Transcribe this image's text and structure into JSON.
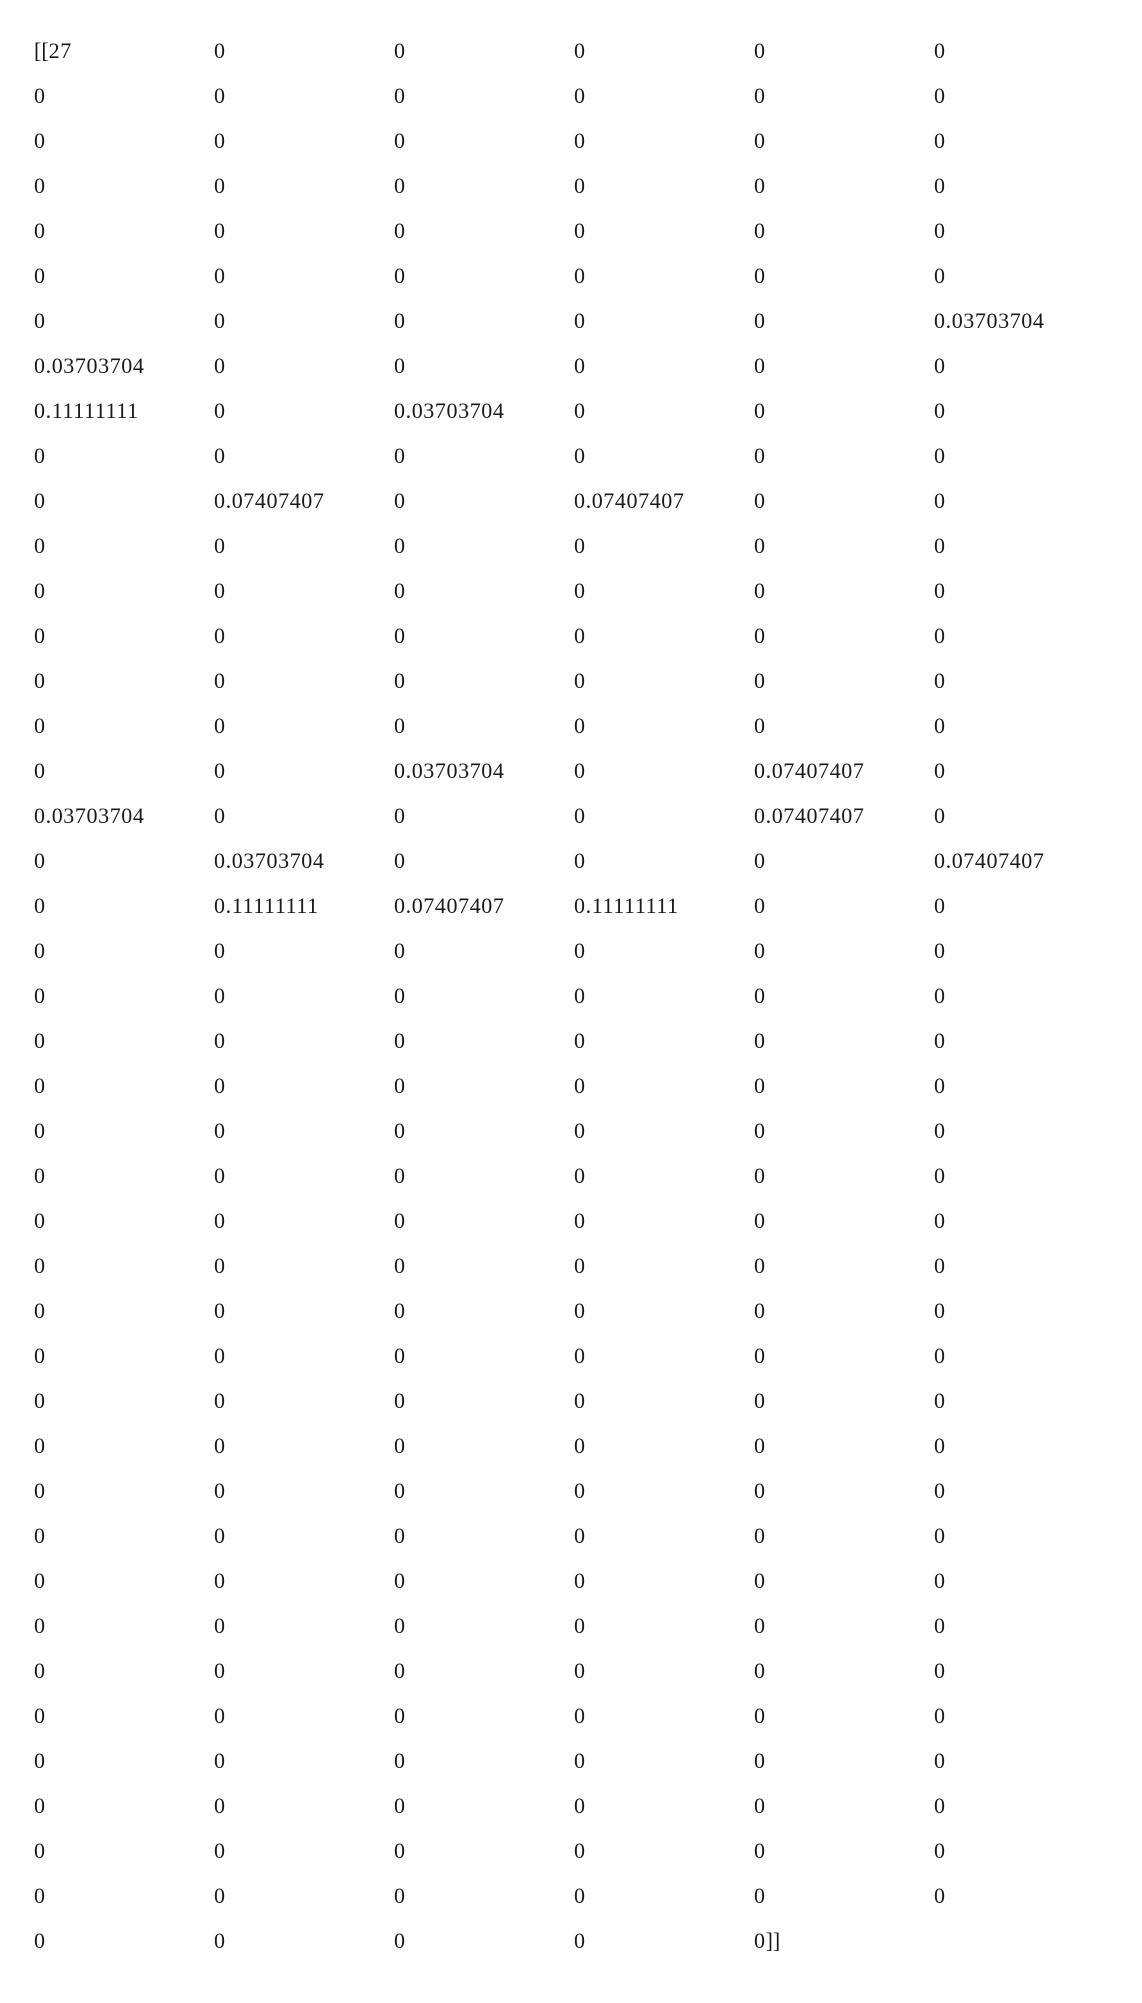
{
  "matrix": {
    "open": "[[",
    "close": "]]",
    "rows": [
      [
        "27",
        "0",
        "0",
        "0",
        "0",
        "0"
      ],
      [
        "0",
        "0",
        "0",
        "0",
        "0",
        "0"
      ],
      [
        "0",
        "0",
        "0",
        "0",
        "0",
        "0"
      ],
      [
        "0",
        "0",
        "0",
        "0",
        "0",
        "0"
      ],
      [
        "0",
        "0",
        "0",
        "0",
        "0",
        "0"
      ],
      [
        "0",
        "0",
        "0",
        "0",
        "0",
        "0"
      ],
      [
        "0",
        "0",
        "0",
        "0",
        "0",
        "0.03703704"
      ],
      [
        "0.03703704",
        "0",
        "0",
        "0",
        "0",
        "0"
      ],
      [
        "0.11111111",
        "0",
        "0.03703704",
        "0",
        "0",
        "0"
      ],
      [
        "0",
        "0",
        "0",
        "0",
        "0",
        "0"
      ],
      [
        "0",
        "0.07407407",
        "0",
        "0.07407407",
        "0",
        "0"
      ],
      [
        "0",
        "0",
        "0",
        "0",
        "0",
        "0"
      ],
      [
        "0",
        "0",
        "0",
        "0",
        "0",
        "0"
      ],
      [
        "0",
        "0",
        "0",
        "0",
        "0",
        "0"
      ],
      [
        "0",
        "0",
        "0",
        "0",
        "0",
        "0"
      ],
      [
        "0",
        "0",
        "0",
        "0",
        "0",
        "0"
      ],
      [
        "0",
        "0",
        "0.03703704",
        "0",
        "0.07407407",
        "0"
      ],
      [
        "0.03703704",
        "0",
        "0",
        "0",
        "0.07407407",
        "0"
      ],
      [
        "0",
        "0.03703704",
        "0",
        "0",
        "0",
        "0.07407407"
      ],
      [
        "0",
        "0.11111111",
        "0.07407407",
        "0.11111111",
        "0",
        "0"
      ],
      [
        "0",
        "0",
        "0",
        "0",
        "0",
        "0"
      ],
      [
        "0",
        "0",
        "0",
        "0",
        "0",
        "0"
      ],
      [
        "0",
        "0",
        "0",
        "0",
        "0",
        "0"
      ],
      [
        "0",
        "0",
        "0",
        "0",
        "0",
        "0"
      ],
      [
        "0",
        "0",
        "0",
        "0",
        "0",
        "0"
      ],
      [
        "0",
        "0",
        "0",
        "0",
        "0",
        "0"
      ],
      [
        "0",
        "0",
        "0",
        "0",
        "0",
        "0"
      ],
      [
        "0",
        "0",
        "0",
        "0",
        "0",
        "0"
      ],
      [
        "0",
        "0",
        "0",
        "0",
        "0",
        "0"
      ],
      [
        "0",
        "0",
        "0",
        "0",
        "0",
        "0"
      ],
      [
        "0",
        "0",
        "0",
        "0",
        "0",
        "0"
      ],
      [
        "0",
        "0",
        "0",
        "0",
        "0",
        "0"
      ],
      [
        "0",
        "0",
        "0",
        "0",
        "0",
        "0"
      ],
      [
        "0",
        "0",
        "0",
        "0",
        "0",
        "0"
      ],
      [
        "0",
        "0",
        "0",
        "0",
        "0",
        "0"
      ],
      [
        "0",
        "0",
        "0",
        "0",
        "0",
        "0"
      ],
      [
        "0",
        "0",
        "0",
        "0",
        "0",
        "0"
      ],
      [
        "0",
        "0",
        "0",
        "0",
        "0",
        "0"
      ],
      [
        "0",
        "0",
        "0",
        "0",
        "0",
        "0"
      ],
      [
        "0",
        "0",
        "0",
        "0",
        "0",
        "0"
      ],
      [
        "0",
        "0",
        "0",
        "0",
        "0",
        "0"
      ],
      [
        "0",
        "0",
        "0",
        "0",
        "0",
        "0"
      ],
      [
        "0",
        "0",
        "0",
        "0",
        "0"
      ]
    ]
  }
}
